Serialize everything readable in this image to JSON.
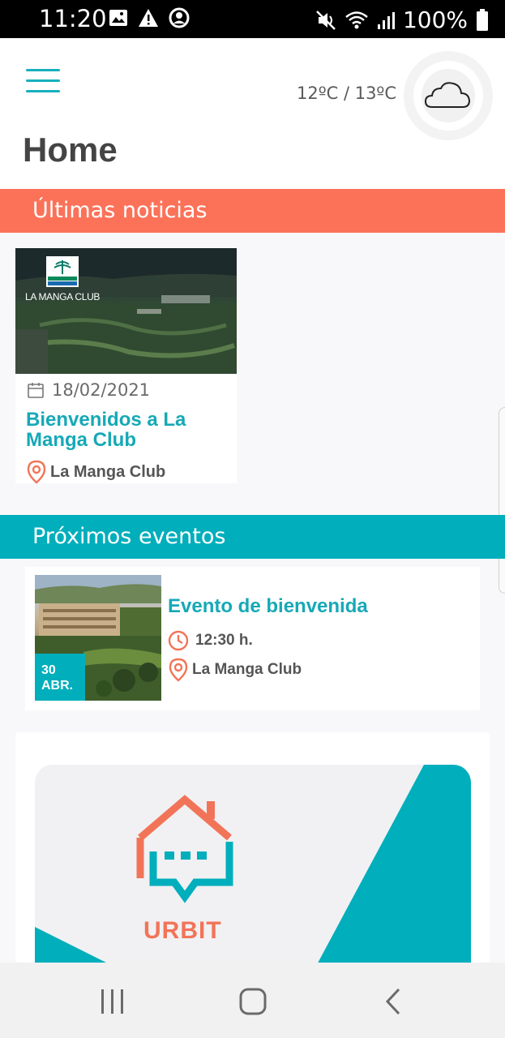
{
  "status_bar": {
    "time": "11:20",
    "battery": "100%",
    "icons": [
      "image-icon",
      "warning-icon",
      "account-icon",
      "mute-icon",
      "wifi-icon",
      "signal-icon",
      "battery-icon"
    ]
  },
  "header": {
    "temperature": "12ºC / 13ºC",
    "weather_icon": "cloud-icon",
    "title": "Home"
  },
  "news": {
    "section_title": "Últimas noticias",
    "items": [
      {
        "image_caption": "LA MANGA CLUB",
        "date": "18/02/2021",
        "title": "Bienvenidos a La Manga Club",
        "location": "La Manga Club"
      }
    ]
  },
  "events": {
    "section_title": "Próximos eventos",
    "items": [
      {
        "day": "30",
        "month": "ABR.",
        "title": "Evento de bienvenida",
        "time": "12:30 h.",
        "location": "La Manga Club"
      }
    ]
  },
  "banner": {
    "brand": "URBIT"
  },
  "colors": {
    "accent_teal": "#00aebc",
    "accent_coral": "#fb7259",
    "title_teal": "#16a9b6"
  }
}
